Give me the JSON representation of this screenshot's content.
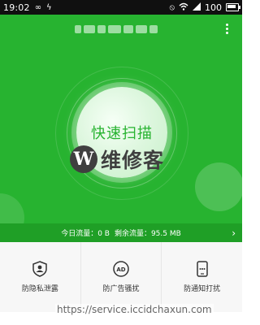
{
  "status_bar": {
    "time": "19:02",
    "icons": [
      "infinity-icon",
      "lightning-icon",
      "vibrate-icon",
      "wifi-icon",
      "signal-icon"
    ],
    "battery": "100"
  },
  "header": {
    "menu_icon": "more-vertical-icon"
  },
  "scan": {
    "label": "快速扫描"
  },
  "traffic": {
    "today": "今日流量：0 B",
    "remaining": "剩余流量：95.5 MB",
    "chevron": "›"
  },
  "features": [
    {
      "label": "防隐私泄露",
      "icon": "shield-user-icon"
    },
    {
      "label": "防广告骚扰",
      "icon": "ad-block-icon"
    },
    {
      "label": "防通知打扰",
      "icon": "phone-notification-icon"
    }
  ],
  "watermark": {
    "logo_text": "维修客",
    "logo_mark": "W",
    "url": "https://service.iccidchaxun.com"
  },
  "colors": {
    "green": "#27b330",
    "green_dark": "#1f9f26",
    "status_bar": "#101010"
  }
}
